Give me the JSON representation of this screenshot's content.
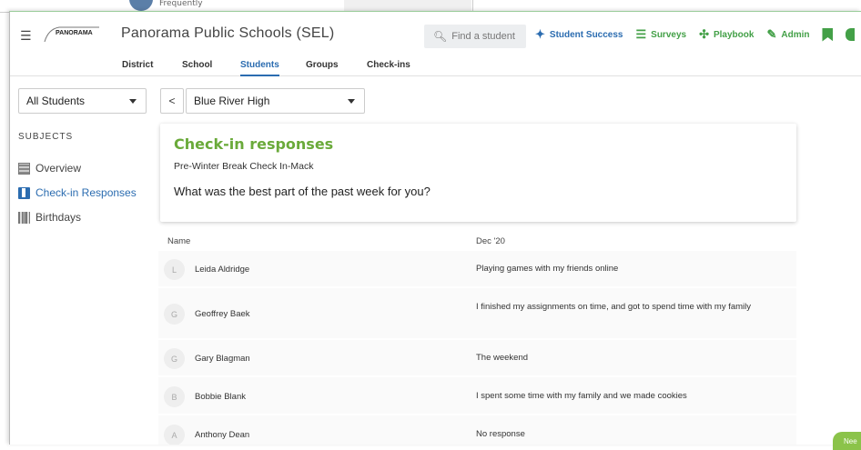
{
  "background_window": {
    "frequency_text": "Frequently"
  },
  "header": {
    "logo_text": "PANORAMA",
    "title": "Panorama Public Schools (SEL)",
    "search_placeholder": "Find a student",
    "nav": [
      {
        "label": "Student Success",
        "icon": "star-icon",
        "color": "#2b6cb0"
      },
      {
        "label": "Surveys",
        "icon": "surveys-icon",
        "color": "#43a047"
      },
      {
        "label": "Playbook",
        "icon": "playbook-icon",
        "color": "#43a047"
      },
      {
        "label": "Admin",
        "icon": "admin-icon",
        "color": "#43a047"
      }
    ]
  },
  "tabs": [
    {
      "label": "District",
      "active": false
    },
    {
      "label": "School",
      "active": false
    },
    {
      "label": "Students",
      "active": true
    },
    {
      "label": "Groups",
      "active": false
    },
    {
      "label": "Check-ins",
      "active": false
    }
  ],
  "filters": {
    "student_scope": "All Students",
    "back_label": "<",
    "school": "Blue River High"
  },
  "sidebar": {
    "heading": "SUBJECTS",
    "items": [
      {
        "label": "Overview",
        "icon": "overview-icon",
        "active": false
      },
      {
        "label": "Check-in Responses",
        "icon": "checkin-icon",
        "active": true
      },
      {
        "label": "Birthdays",
        "icon": "birthday-icon",
        "active": false
      }
    ]
  },
  "card": {
    "title": "Check-in responses",
    "subtitle": "Pre-Winter Break Check In-Mack",
    "question": "What was the best part of the past week for you?"
  },
  "table": {
    "col_name": "Name",
    "col_date": "Dec '20",
    "rows": [
      {
        "initial": "L",
        "name": "Leida Aldridge",
        "response": "Playing games with my friends online"
      },
      {
        "initial": "G",
        "name": "Geoffrey Baek",
        "response": "I finished my assignments on time, and got to spend time with my family"
      },
      {
        "initial": "G",
        "name": "Gary Blagman",
        "response": "The weekend"
      },
      {
        "initial": "B",
        "name": "Bobbie Blank",
        "response": "I spent some time with my family and we made cookies"
      },
      {
        "initial": "A",
        "name": "Anthony Dean",
        "response": "No response"
      }
    ]
  },
  "corner_badge": "Nee",
  "colors": {
    "accent_blue": "#2b6cb0",
    "accent_green": "#43a047",
    "title_green": "#6aaa3a"
  }
}
